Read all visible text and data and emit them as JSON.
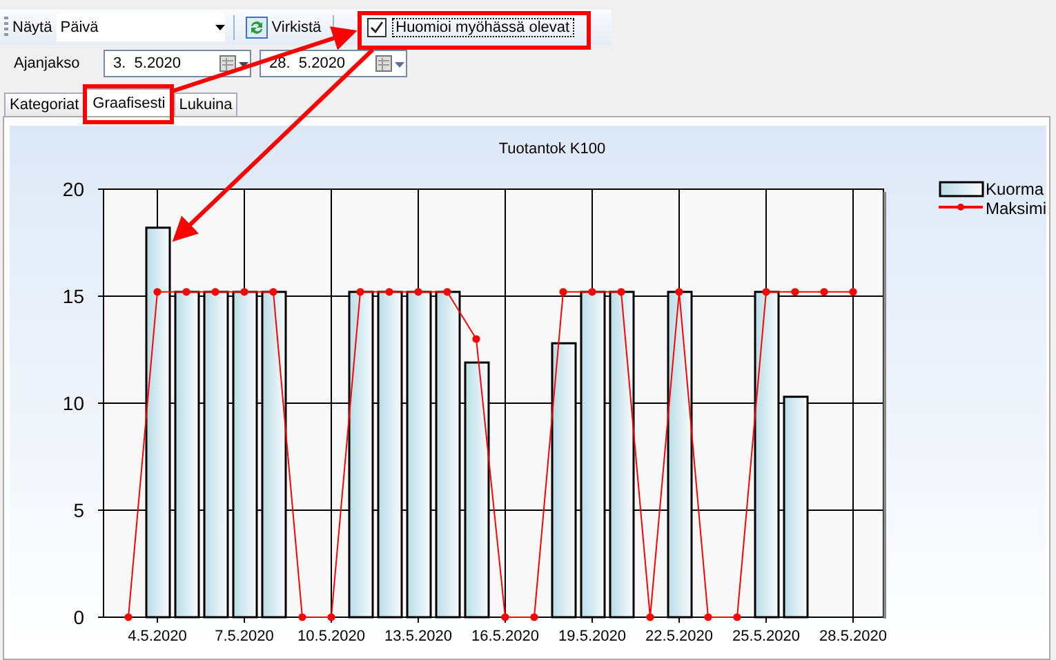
{
  "toolbar": {
    "show_label": "Näytä",
    "show_value": "Päivä",
    "refresh_button": "Virkistä",
    "late_checkbox": {
      "label": "Huomioi myöhässä olevat",
      "checked": true
    }
  },
  "period": {
    "label": "Ajanjakso",
    "start": "3.  5.2020",
    "end": "28.  5.2020"
  },
  "tabs": [
    {
      "label": "Kategoriat",
      "selected": false
    },
    {
      "label": "Graafisesti",
      "selected": true
    },
    {
      "label": "Lukuina",
      "selected": false
    }
  ],
  "chart": {
    "chart_data": {
      "type": "bar",
      "title": "Tuotantok K100",
      "categories": [
        null,
        "4.5.2020",
        null,
        null,
        "7.5.2020",
        null,
        null,
        "10.5.2020",
        null,
        null,
        "13.5.2020",
        null,
        null,
        "16.5.2020",
        null,
        null,
        "19.5.2020",
        null,
        null,
        "22.5.2020",
        null,
        null,
        "25.5.2020",
        null,
        null,
        "28.5.2020"
      ],
      "grid": true,
      "legend": true,
      "ylim": [
        0,
        20
      ],
      "yticks": [
        0,
        5,
        10,
        15,
        20
      ],
      "series": [
        {
          "name": "Kuorma",
          "color": "#b9dde6",
          "values": [
            null,
            18.2,
            15.2,
            15.2,
            15.2,
            15.2,
            null,
            null,
            15.2,
            15.2,
            15.2,
            15.2,
            11.9,
            null,
            null,
            12.8,
            15.2,
            15.2,
            null,
            15.2,
            null,
            null,
            15.2,
            10.3,
            null,
            null
          ]
        },
        {
          "name": "Maksimi",
          "type": "line",
          "marker": "circle",
          "color": "#ff0000",
          "values": [
            0,
            15.2,
            15.2,
            15.2,
            15.2,
            15.2,
            0,
            0,
            15.2,
            15.2,
            15.2,
            15.2,
            13,
            0,
            0,
            15.2,
            15.2,
            15.2,
            0,
            15.2,
            0,
            0,
            15.2,
            15.2,
            15.2,
            15.2
          ]
        }
      ]
    }
  }
}
